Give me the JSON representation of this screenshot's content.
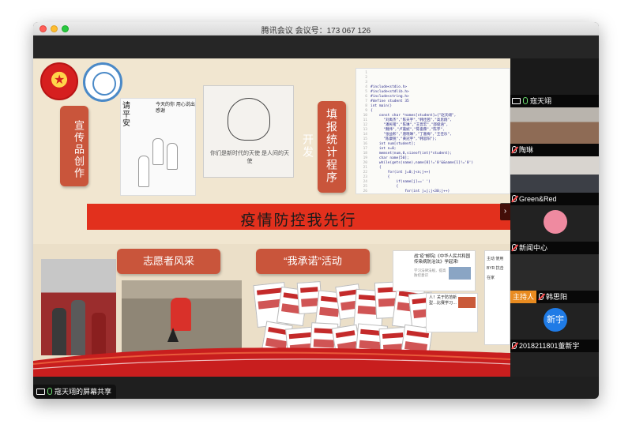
{
  "window": {
    "title": "腾讯会议 会议号：173 067 126"
  },
  "slide": {
    "label_publicity": "宣传品创作",
    "label_program": "填报统计程序开发",
    "banner": "疫情防控我先行",
    "label_volunteer": "志愿者风采",
    "label_pledge": "“我承诺”活动",
    "poster_note_top": "今天的你 用心说出感谢",
    "poster_note_left": "请平安",
    "poster_caption": "你们是新时代的天使 是人间的天使",
    "phone_headline": "战“疫”邮院|《中华人民共和国传染病防治法》学起来!",
    "phone_sub": "学习法律法规，提高防控意识",
    "phone_headline_2": "人！关于防范新型…比赛学习…",
    "phone_side": "主动 使用 BYR 抗击 在家",
    "code_lines": [
      "#include<stdio.h>",
      "#include<stdlib.h>",
      "#include<string.h>",
      "#define student 35",
      "int main()",
      "{",
      "    const char *names[student]={\"赵天翊\",",
      "      \"刘禹杰\",\"陈天宇\",\"韩佳茜\",\"高思翔\",",
      "      \"潘民锴\",\"陈琳\",\"王晋宏\",\"邵俊涵\",",
      "      \"魏伟\",\"卢嘉妮\",\"陈俊霖\",\"陈宇\",",
      "      \"张益彰\",\"唐晓琳\",\"丁嘉梅\",\"王佳乐\",",
      "      \"陈康锐\",\"黄冠宇\",\"韩思阳\"};",
      "    int num[student];",
      "    int n=0;",
      "    memset(num,0,sizeof(int)*student);",
      "    char name[50];",
      "    while(gets(name),name[0]!='0'&&name[1]!='0')",
      "    {",
      "        for(int j=0;j<n;j++)",
      "        {",
      "            if(name[j]==' ')",
      "            {",
      "                for(int j=j;j<30;j++)",
      "                {",
      "                    name[j]='\\0';",
      "                }",
      "            }",
      "        }",
      "    }"
    ]
  },
  "participants": [
    {
      "name": "寇天翊",
      "mic": "on",
      "sharing": true,
      "avatar": "",
      "avatar_color": ""
    },
    {
      "name": "陶琳",
      "mic": "off",
      "sharing": false,
      "avatar": "",
      "avatar_color": ""
    },
    {
      "name": "Green&Red",
      "mic": "off",
      "sharing": false,
      "avatar": "",
      "avatar_color": ""
    },
    {
      "name": "新闻中心",
      "mic": "off",
      "sharing": false,
      "avatar": "",
      "avatar_color": "#ef8aa0"
    },
    {
      "name": "韩思阳",
      "mic": "off",
      "sharing": false,
      "host_badge": "主持人",
      "avatar": "",
      "avatar_color": ""
    },
    {
      "name": "2018211801董新宇",
      "mic": "off",
      "sharing": false,
      "avatar": "新宇",
      "avatar_color": "#1f7be6"
    },
    {
      "name": "",
      "mic": "off",
      "sharing": false,
      "avatar": "",
      "avatar_color": ""
    }
  ],
  "share_status": "寇天翊的屏幕共享",
  "colors": {
    "accent_red": "#e2301d",
    "label_red": "#c9553b",
    "host_orange": "#e98b20",
    "mic_green": "#6de071"
  },
  "icons": [
    "share-screen-icon",
    "mic-icon",
    "mic-muted-icon",
    "expand-arrow-icon"
  ]
}
